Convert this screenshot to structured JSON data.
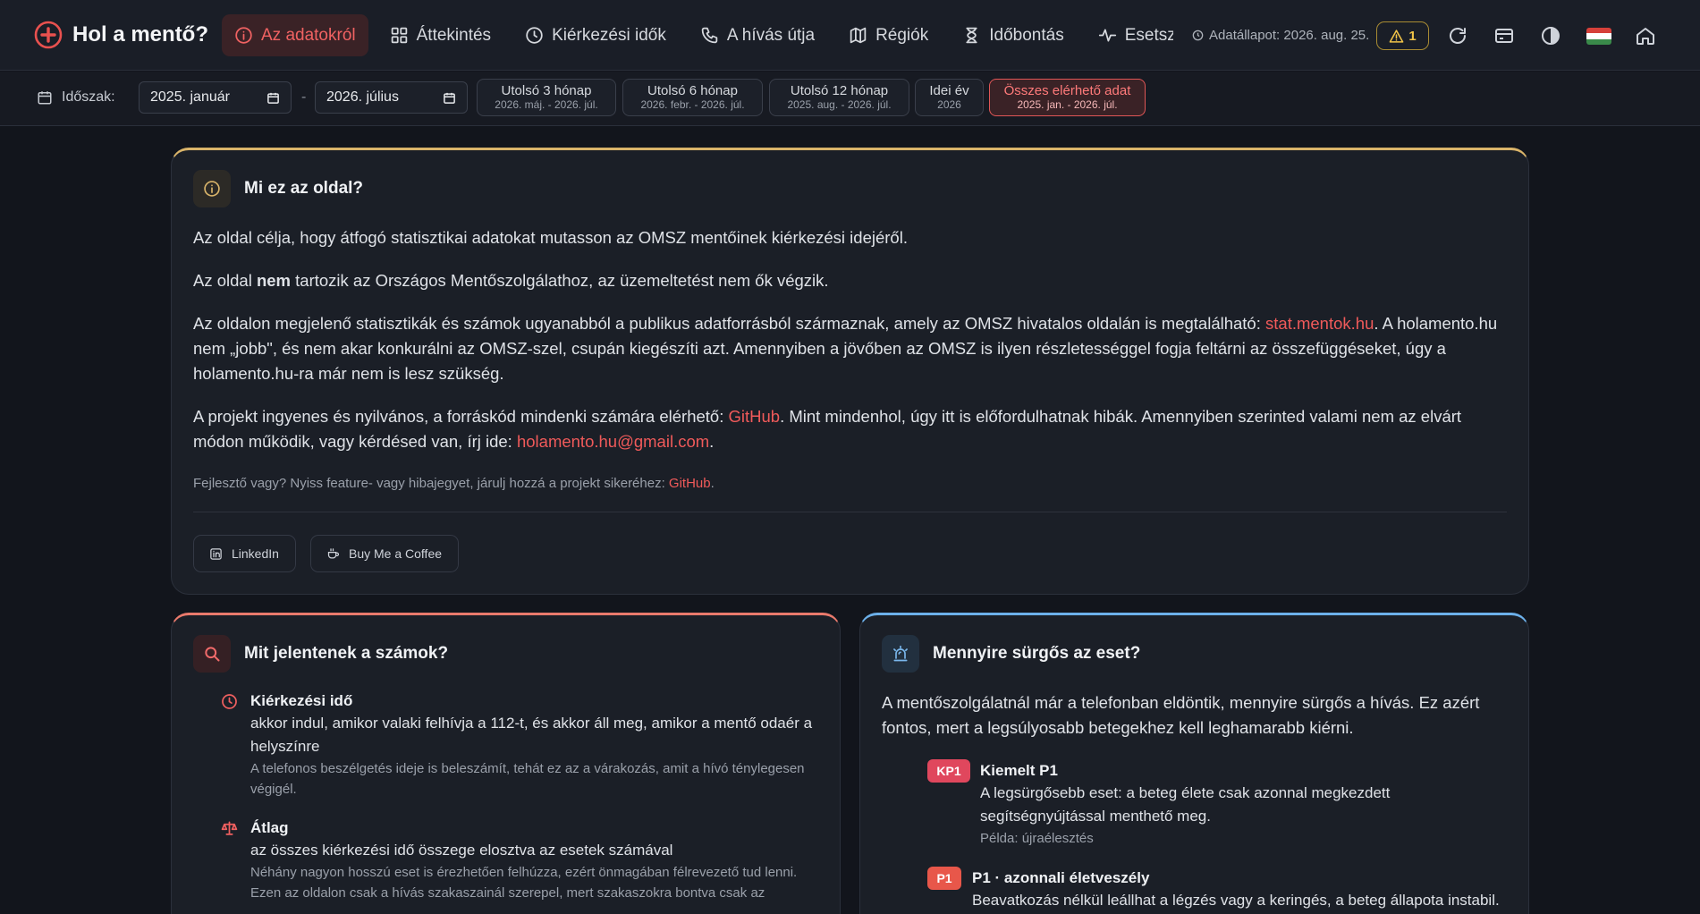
{
  "app": {
    "title": "Hol a mentő?"
  },
  "nav": {
    "tabs": [
      {
        "label": "Az adatokról",
        "icon": "info-icon",
        "active": true
      },
      {
        "label": "Áttekintés",
        "icon": "grid-icon"
      },
      {
        "label": "Kiérkezési idők",
        "icon": "clock-icon"
      },
      {
        "label": "A hívás útja",
        "icon": "phone-icon"
      },
      {
        "label": "Régiók",
        "icon": "map-icon"
      },
      {
        "label": "Időbontás",
        "icon": "hourglass-icon"
      },
      {
        "label": "Esetszám",
        "icon": "activity-icon"
      }
    ]
  },
  "status": {
    "text": "Adatállapot: 2026. aug. 25.",
    "warning_count": "1"
  },
  "colors": {
    "accent": "#f05a5a",
    "warning": "#f0c348",
    "gold": "#d9b46a",
    "blue": "#6cb0ea"
  },
  "period": {
    "label": "Időszak:",
    "from": "2025. január",
    "to": "2026. július",
    "separator": "-",
    "presets": [
      {
        "label": "Utolsó 3 hónap",
        "range": "2026. máj. - 2026. júl."
      },
      {
        "label": "Utolsó 6 hónap",
        "range": "2026. febr. - 2026. júl."
      },
      {
        "label": "Utolsó 12 hónap",
        "range": "2025. aug. - 2026. júl."
      },
      {
        "label": "Idei év",
        "range": "2026"
      },
      {
        "label": "Összes elérhető adat",
        "range": "2025. jan. - 2026. júl.",
        "selected": true
      }
    ]
  },
  "about": {
    "title": "Mi ez az oldal?",
    "p1": "Az oldal célja, hogy átfogó statisztikai adatokat mutasson az OMSZ mentőinek kiérkezési idejéről.",
    "p2_pre": "Az oldal ",
    "p2_bold": "nem",
    "p2_post": " tartozik az Országos Mentőszolgálathoz, az üzemeltetést nem ők végzik.",
    "p3_pre": "Az oldalon megjelenő statisztikák és számok ugyanabból a publikus adatforrásból származnak, amely az OMSZ hivatalos oldalán is megtalálható: ",
    "p3_link": "stat.mentok.hu",
    "p3_post": ". A holamento.hu nem „jobb\", és nem akar konkurálni az OMSZ-szel, csupán kiegészíti azt. Amennyiben a jövőben az OMSZ is ilyen részletességgel fogja feltárni az összefüggéseket, úgy a holamento.hu-ra már nem is lesz szükség.",
    "p4_pre": "A projekt ingyenes és nyilvános, a forráskód mindenki számára elérhető: ",
    "p4_link": "GitHub",
    "p4_mid": ". Mint mindenhol, úgy itt is előfordulhatnak hibák. Amennyiben szerinted valami nem az elvárt módon működik, vagy kérdésed van, írj ide: ",
    "p4_email": "holamento.hu@gmail.com",
    "p4_end": ".",
    "dev_pre": "Fejlesztő vagy? Nyiss feature- vagy hibajegyet, járulj hozzá a projekt sikeréhez: ",
    "dev_link": "GitHub",
    "dev_end": ".",
    "linkedin": "LinkedIn",
    "coffee": "Buy Me a Coffee"
  },
  "numbers": {
    "title": "Mit jelentenek a számok?",
    "items": [
      {
        "title": "Kiérkezési idő",
        "desc": "akkor indul, amikor valaki felhívja a 112-t, és akkor áll meg, amikor a mentő odaér a helyszínre",
        "note": "A telefonos beszélgetés ideje is beleszámít, tehát ez az a várakozás, amit a hívó ténylegesen végigél."
      },
      {
        "title": "Átlag",
        "desc": "az összes kiérkezési idő összege elosztva az esetek számával",
        "note": "Néhány nagyon hosszú eset is érezhetően felhúzza, ezért önmagában félrevezető tud lenni. Ezen az oldalon csak a hívás szakaszainál szerepel, mert szakaszokra bontva csak az"
      }
    ]
  },
  "urgency": {
    "title": "Mennyire sürgős az eset?",
    "intro": "A mentőszolgálatnál már a telefonban eldöntik, mennyire sürgős a hívás. Ez azért fontos, mert a legsúlyosabb betegekhez kell leghamarabb kiérni.",
    "levels": [
      {
        "badge": "KP1",
        "title": "Kiemelt P1",
        "desc": "A legsürgősebb eset: a beteg élete csak azonnal megkezdett segítségnyújtással menthető meg.",
        "example": "Példa: újraélesztés",
        "color": "#e0475d"
      },
      {
        "badge": "P1",
        "title": "P1 · azonnali életveszély",
        "desc": "Beavatkozás nélkül leállhat a légzés vagy a keringés, a beteg állapota instabil.",
        "color": "#e8574a"
      }
    ]
  }
}
